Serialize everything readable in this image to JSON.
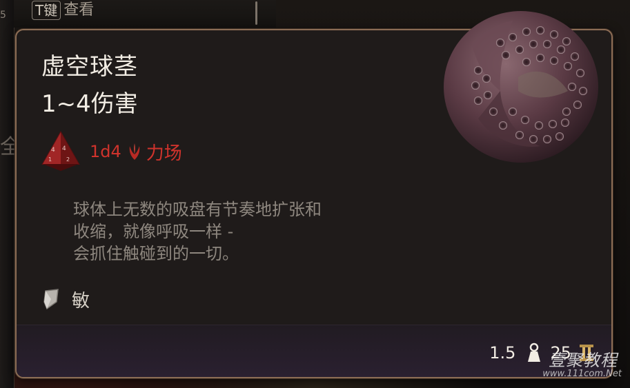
{
  "background": {
    "key_hint_key": "T键",
    "key_hint_label": "查看",
    "edge_number": "5",
    "edge_glyph": "全"
  },
  "item": {
    "name": "虚空球茎",
    "damage_range": "1~4伤害",
    "dice": "1d4",
    "damage_type": "力场",
    "damage_type_icon": "force-claw-icon",
    "flavor_lines": [
      "球体上无数的吸盘有节奏地扩张和",
      "收缩，就像呼吸一样 -",
      "会抓住触碰到的一切。"
    ],
    "property_icon": "finesse-icon",
    "property": "敏",
    "weight": "1.5",
    "value": "25",
    "rarity_icon": "rarity-roman-two-icon"
  },
  "colors": {
    "damage_red": "#d0332c",
    "border": "#8c6d55",
    "text_light": "#f2ede4",
    "text_muted": "#8e877f"
  },
  "watermark": {
    "main": "壹聚教程",
    "sub": "www.111com.Net"
  }
}
